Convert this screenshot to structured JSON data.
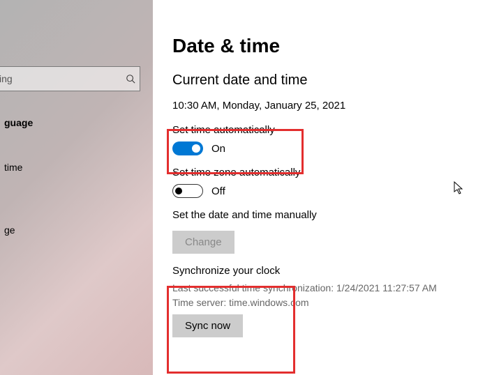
{
  "sidebar": {
    "search_placeholder": "ing",
    "items": [
      {
        "label": "guage",
        "active": true
      },
      {
        "label": "time",
        "active": false
      },
      {
        "label": "ge",
        "active": false
      }
    ]
  },
  "page": {
    "title": "Date & time",
    "section_title": "Current date and time",
    "current_datetime": "10:30 AM, Monday, January 25, 2021",
    "set_time_auto": {
      "label": "Set time automatically",
      "state_label": "On",
      "on": true
    },
    "set_tz_auto": {
      "label": "Set time zone automatically",
      "state_label": "Off",
      "on": false
    },
    "manual": {
      "label": "Set the date and time manually",
      "button": "Change"
    },
    "sync": {
      "heading": "Synchronize your clock",
      "last_sync": "Last successful time synchronization: 1/24/2021 11:27:57 AM",
      "server": "Time server: time.windows.com",
      "button": "Sync now"
    }
  }
}
